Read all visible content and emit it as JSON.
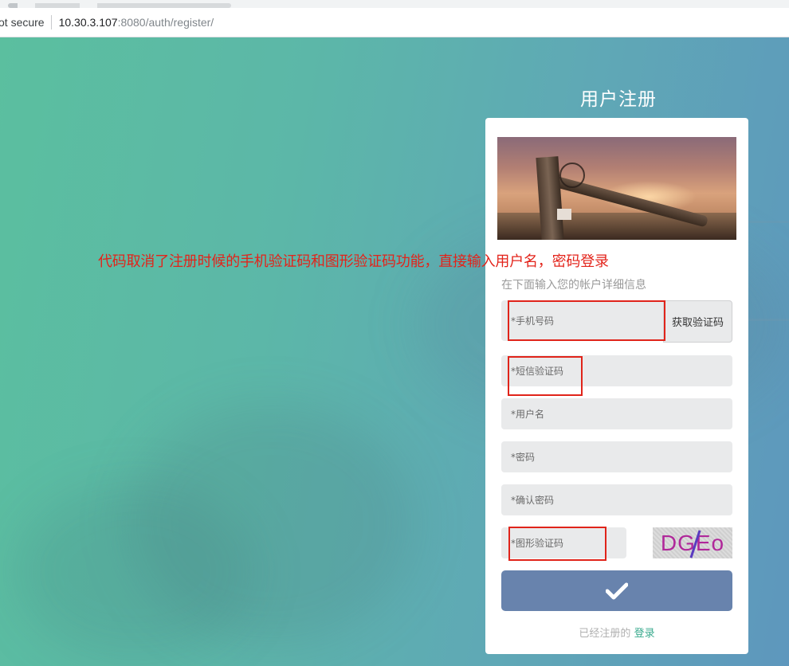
{
  "browser": {
    "security_label": "ot secure",
    "url_host": "10.30.3.107",
    "url_path": ":8080/auth/register/"
  },
  "page": {
    "heading": "用户注册",
    "annotation": "代码取消了注册时候的手机验证码和图形验证码功能，直接输入用户名，密码登录"
  },
  "form": {
    "subtitle": "在下面输入您的帐户详细信息",
    "phone_placeholder": "*手机号码",
    "sms_button_label": "获取验证码",
    "sms_code_placeholder": "*短信验证码",
    "username_placeholder": "*用户名",
    "password_placeholder": "*密码",
    "confirm_password_placeholder": "*确认密码",
    "captcha_placeholder": "*图形验证码",
    "captcha_text": "DGEo",
    "submit_icon": "check-icon",
    "already_registered": "已经注册的",
    "login_link": "登录"
  },
  "colors": {
    "annotation": "#e3231a",
    "submit_button": "#6883ad",
    "login_link": "#3aaa8e",
    "highlight_box": "#e0241a"
  }
}
